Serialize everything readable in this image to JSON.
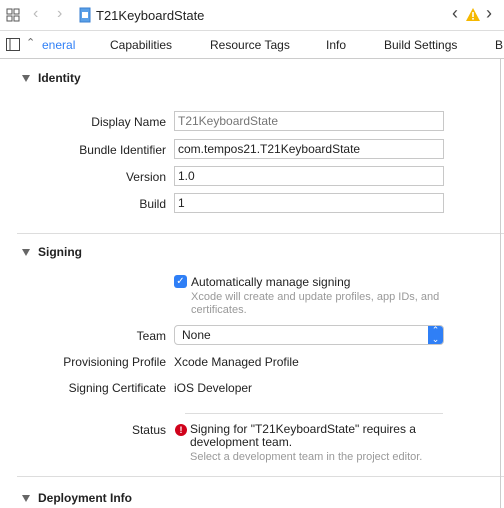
{
  "toolbar": {
    "title": "T21KeyboardState",
    "warning_color": "#f5b800"
  },
  "tabs": [
    "eneral",
    "Capabilities",
    "Resource Tags",
    "Info",
    "Build Settings",
    "B"
  ],
  "identity": {
    "title": "Identity",
    "display_name_label": "Display Name",
    "display_name_placeholder": "T21KeyboardState",
    "bundle_label": "Bundle Identifier",
    "bundle_value": "com.tempos21.T21KeyboardState",
    "version_label": "Version",
    "version_value": "1.0",
    "build_label": "Build",
    "build_value": "1"
  },
  "signing": {
    "title": "Signing",
    "auto_label": "Automatically manage signing",
    "auto_checked": true,
    "auto_desc": "Xcode will create and update profiles, app IDs, and certificates.",
    "team_label": "Team",
    "team_value": "None",
    "profile_label": "Provisioning Profile",
    "profile_value": "Xcode Managed Profile",
    "cert_label": "Signing Certificate",
    "cert_value": "iOS Developer",
    "status_label": "Status",
    "status_error": "Signing for \"T21KeyboardState\" requires a development team.",
    "status_hint": "Select a development team in the project editor.",
    "accent": "#2f7ff6",
    "error_color": "#d0021b"
  },
  "deployment": {
    "title": "Deployment Info"
  }
}
